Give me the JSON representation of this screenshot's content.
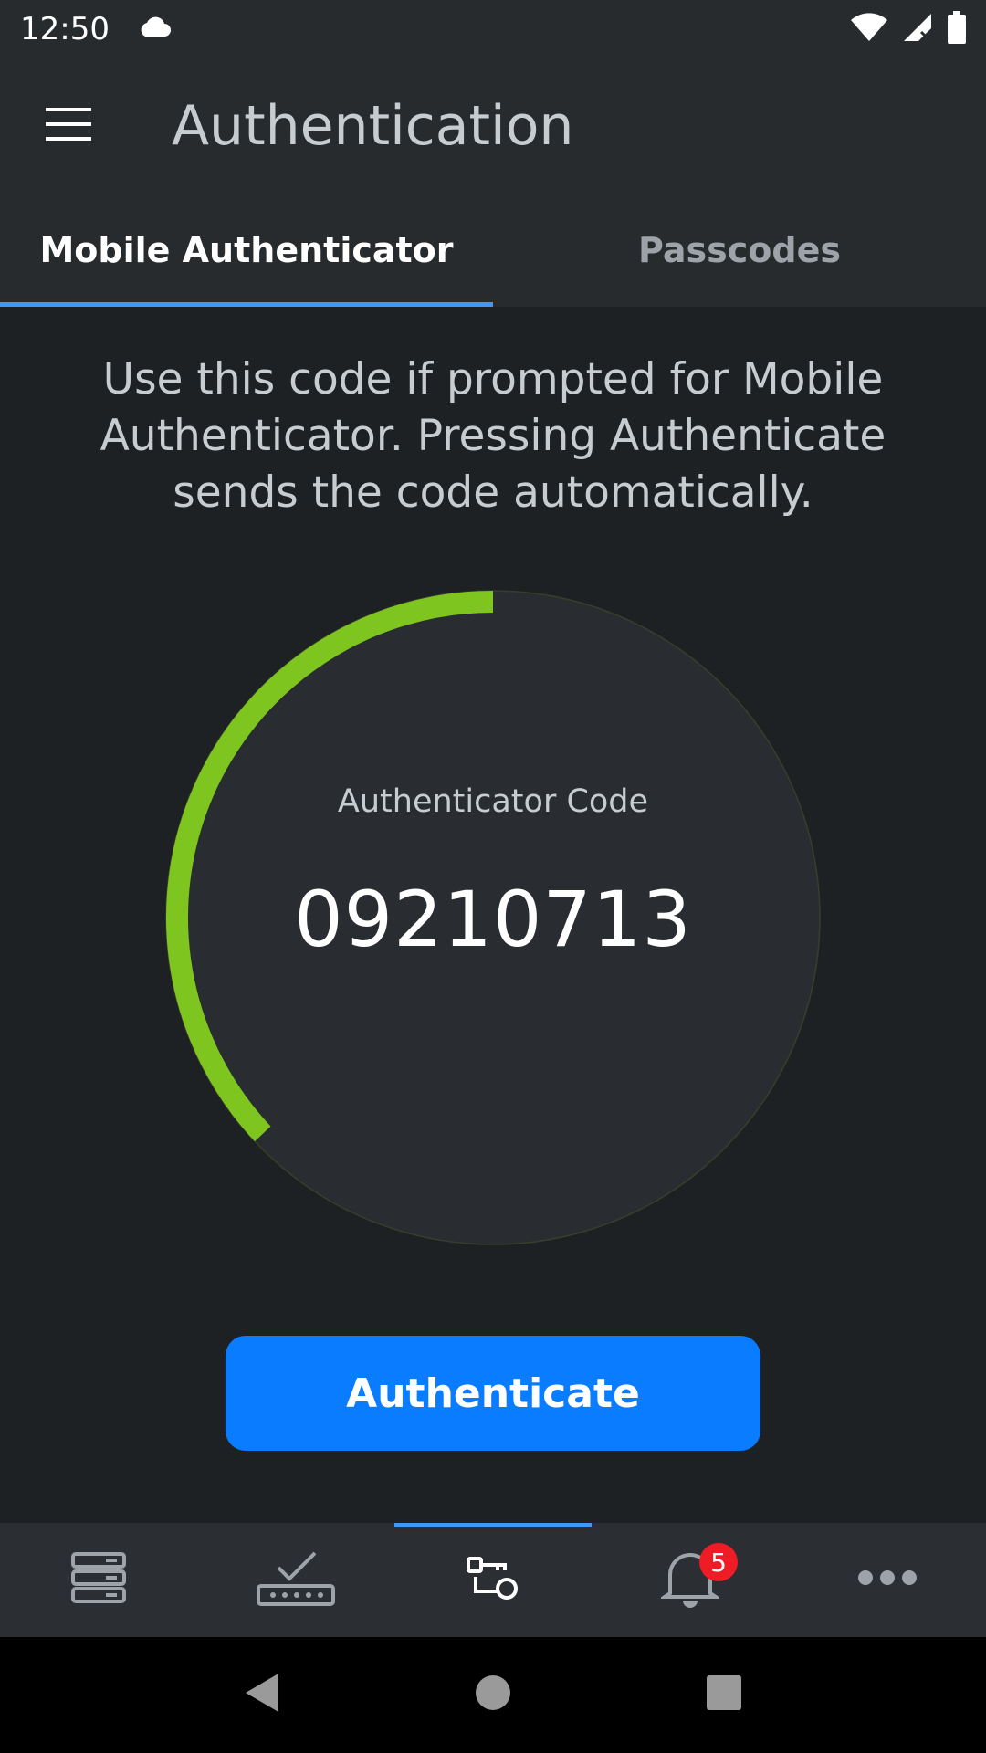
{
  "status_bar": {
    "time": "12:50",
    "icons": [
      "cloud-icon",
      "wifi-icon",
      "cellular-no-signal-icon",
      "battery-icon"
    ]
  },
  "app_bar": {
    "title": "Authentication",
    "menu_icon": "hamburger-menu-icon"
  },
  "tabs": [
    {
      "label": "Mobile Authenticator",
      "active": true
    },
    {
      "label": "Passcodes",
      "active": false
    }
  ],
  "main": {
    "instructions": "Use this code if prompted for Mobile Authenticator. Pressing Authenticate sends the code automatically.",
    "code_label": "Authenticator Code",
    "code_value": "09210713",
    "timer_remaining_fraction": 0.37,
    "timer_color": "#7ec51f",
    "authenticate_label": "Authenticate",
    "button_color": "#0a7cff"
  },
  "bottom_nav": {
    "items": [
      {
        "icon": "servers-icon",
        "active": false
      },
      {
        "icon": "device-check-icon",
        "active": false
      },
      {
        "icon": "keys-icon",
        "active": true
      },
      {
        "icon": "bell-icon",
        "active": false,
        "badge": "5"
      },
      {
        "icon": "more-icon",
        "active": false
      }
    ]
  },
  "system_nav": {
    "icons": [
      "back-icon",
      "home-icon",
      "recents-icon"
    ]
  },
  "colors": {
    "accent": "#3d99f5",
    "badge": "#ee1c24"
  }
}
